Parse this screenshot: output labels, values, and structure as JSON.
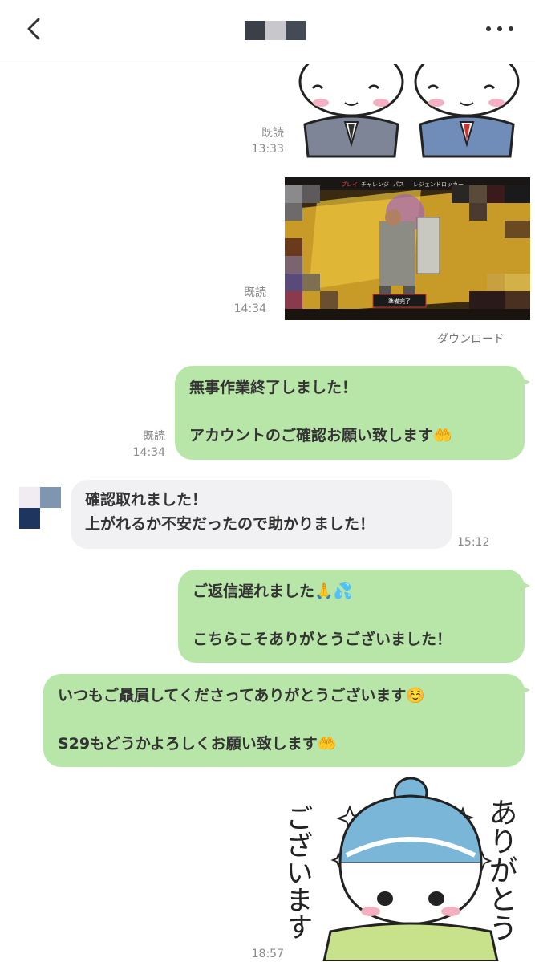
{
  "header": {
    "back_icon": "chevron-left-icon",
    "title_mosaic_colors": [
      "#3b3f48",
      "#c8c8cc",
      "#444a56"
    ],
    "more_icon": "more-dots-icon"
  },
  "messages": {
    "m1": {
      "read": "既読",
      "time": "13:33"
    },
    "m2": {
      "read": "既読",
      "time": "14:34",
      "download": "ダウンロード"
    },
    "m3": {
      "read": "既読",
      "time": "14:34",
      "text": "無事作業終了しました！\n\nアカウントのご確認お願い致します🤲"
    },
    "m4": {
      "time": "15:12",
      "text": "確認取れました！\n上がれるか不安だったので助かりました！"
    },
    "m5": {
      "text": "ご返信遅れました🙏💦\n\nこちらこそありがとうございました！"
    },
    "m6": {
      "text": "いつもご贔屓してくださってありがとうございます☺️\n\nS29もどうかよろしくお願い致します🤲"
    },
    "m7": {
      "time": "18:57"
    }
  },
  "game_screenshot": {
    "tabs": [
      "プレイ",
      "チャレンジ",
      "パス",
      "レジェンドロッカー"
    ],
    "ready_button": "準備完了"
  },
  "sticker_text": {
    "line1": "ありがとう",
    "line2": "ございます"
  },
  "colors": {
    "outgoing_bubble": "#b8e6a8",
    "incoming_bubble": "#f1f1f4"
  }
}
